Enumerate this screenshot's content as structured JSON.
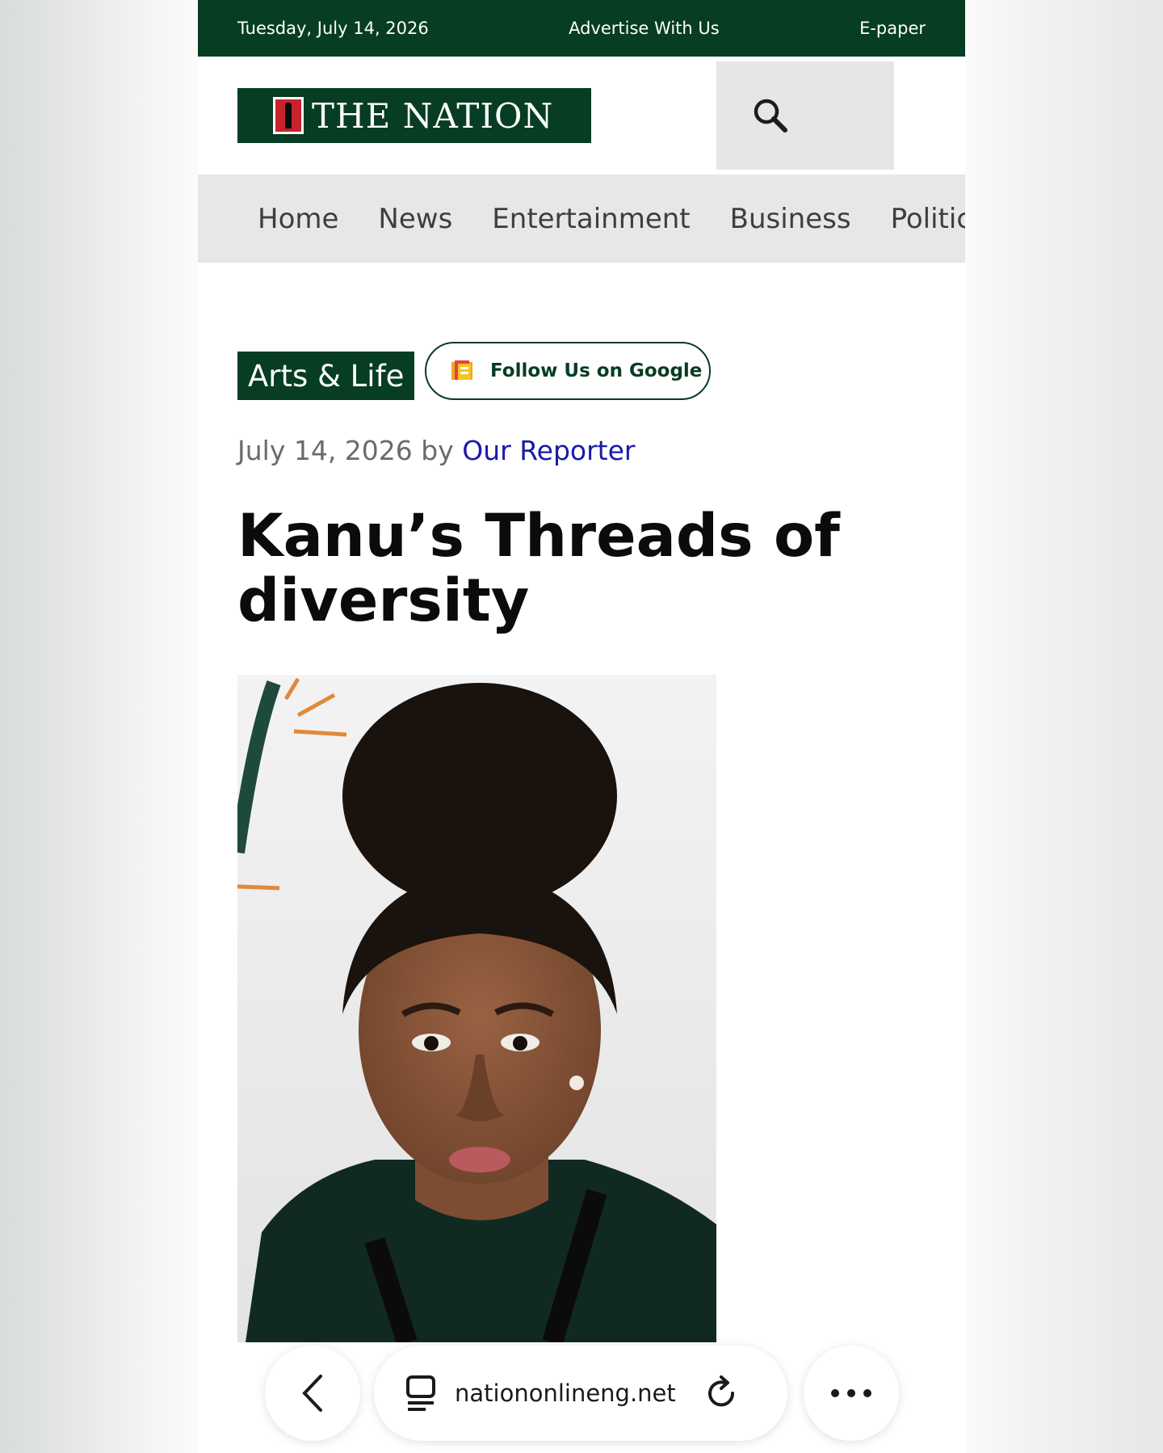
{
  "topbar": {
    "date": "Tuesday, July 14, 2026",
    "advertise": "Advertise With Us",
    "epaper": "E-paper"
  },
  "header": {
    "logo_text": "THE NATION",
    "search_icon": "search-icon"
  },
  "nav": {
    "items": [
      "Home",
      "News",
      "Entertainment",
      "Business",
      "Politic"
    ]
  },
  "article": {
    "category": "Arts & Life",
    "follow_label": "Follow Us on Google",
    "follow_icon": "google-news-icon",
    "date": "July 14, 2026",
    "by": "by",
    "author": "Our Reporter",
    "title": "Kanu’s Threads of diversity",
    "photo_icon": "portrait-photo"
  },
  "browser": {
    "url": "nationonlineng.net",
    "icons": [
      "back-icon",
      "tab-icon",
      "reload-icon",
      "more-icon"
    ]
  },
  "colors": {
    "brand_green": "#073d22",
    "author_link": "#1a1aa8",
    "nav_bg": "#e6e7e6",
    "logo_red": "#c8232c"
  }
}
